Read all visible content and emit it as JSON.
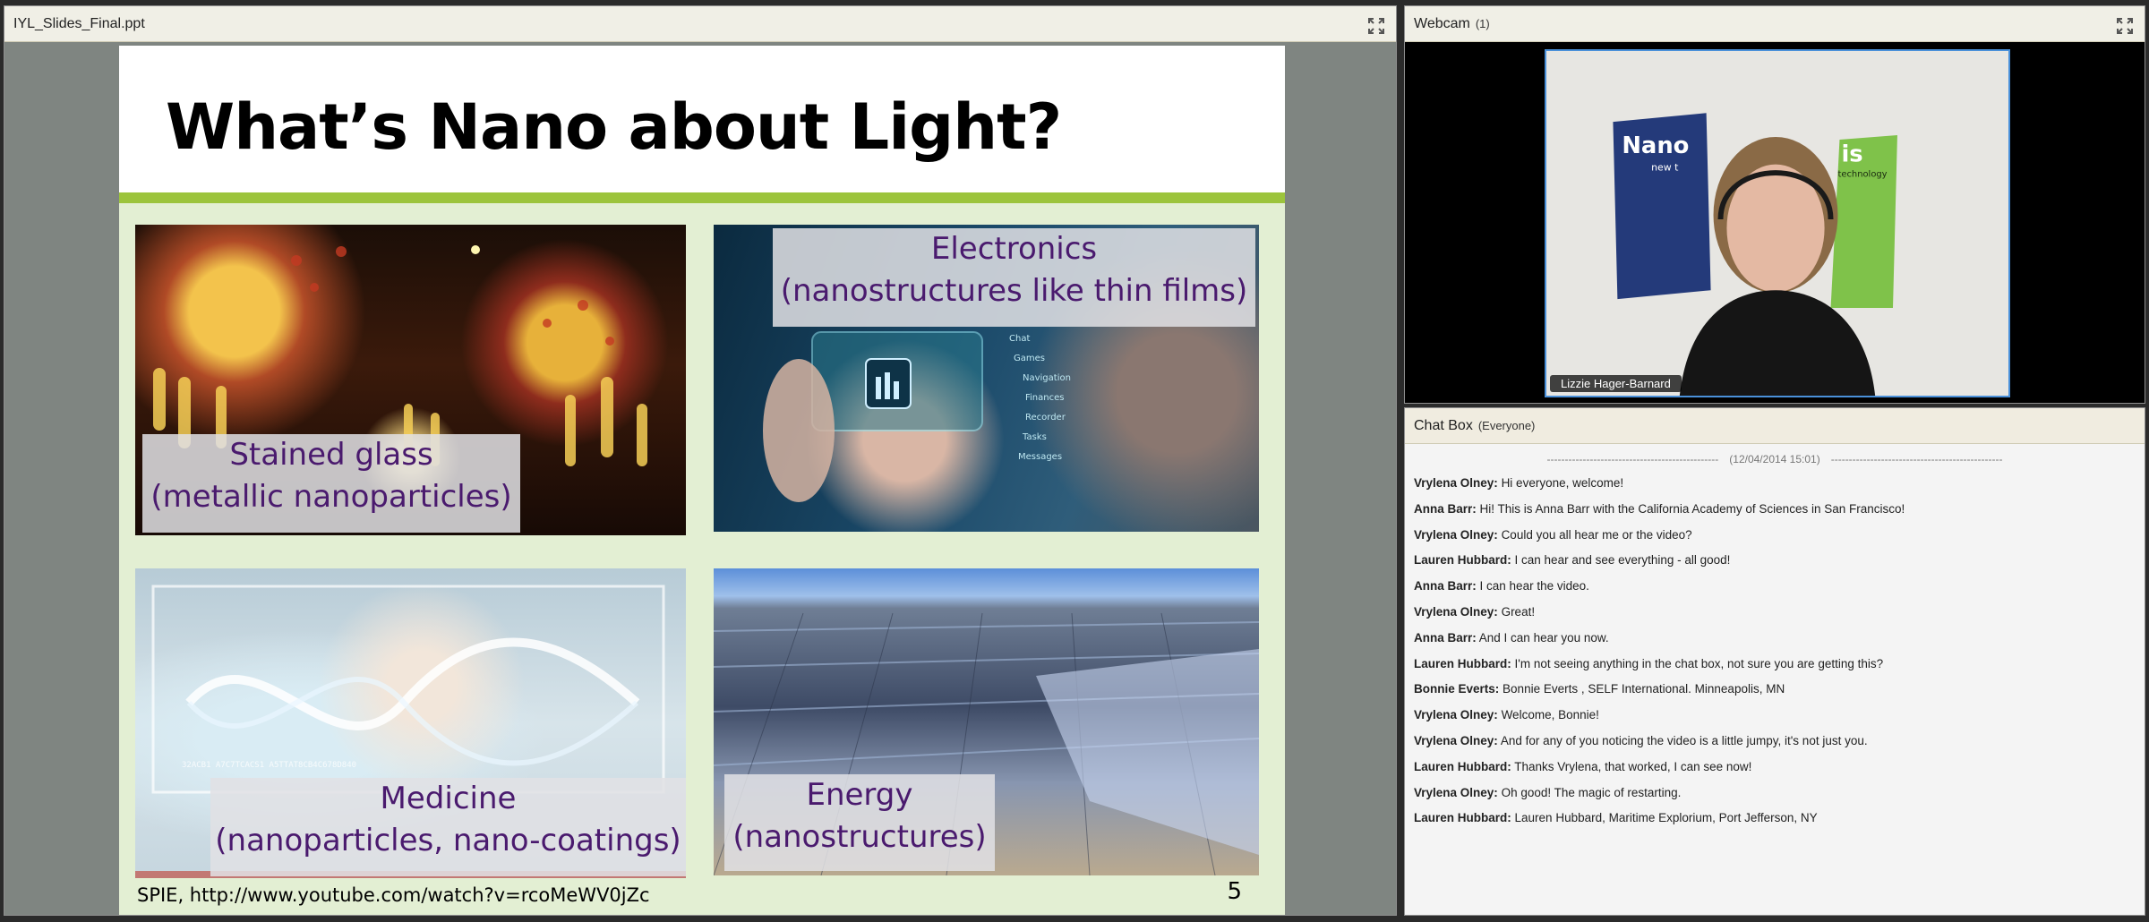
{
  "slides_pod": {
    "title": "IYL_Slides_Final.ppt",
    "expand_icon": "expand-arrows-icon",
    "slide": {
      "title": "What’s Nano about Light?",
      "captions": {
        "glass_line1": "Stained glass",
        "glass_line2": "(metallic nanoparticles)",
        "electronics_line1": "Electronics",
        "electronics_line2": "(nanostructures like thin films)",
        "medicine_line1": "Medicine",
        "medicine_line2": "(nanoparticles, nano-coatings)",
        "energy_line1": "Energy",
        "energy_line2": "(nanostructures)"
      },
      "ui_text": {
        "menu": [
          "Chat",
          "Games",
          "Navigation",
          "Finances",
          "Recorder",
          "Tasks",
          "Messages"
        ],
        "dna": "32ACB1 A7C7TCACS1 A5TTAT8CB4C678D840",
        "poster_left": "Nano",
        "poster_left_sub": "new t",
        "poster_right": "is",
        "poster_right_sub": "technology"
      },
      "footer": "SPIE, http://www.youtube.com/watch?v=rcoMeWV0jZc",
      "number": "5"
    },
    "colors": {
      "accent_green": "#9cc43c",
      "caption_purple": "#4a1a6e"
    }
  },
  "webcam_pod": {
    "title": "Webcam",
    "count": "(1)",
    "expand_icon": "expand-arrows-icon",
    "presenter_name": "Lizzie Hager-Barnard"
  },
  "chat_pod": {
    "title": "Chat Box",
    "scope": "(Everyone)",
    "separator_dashes": "------------------------------------------------",
    "timestamp": "(12/04/2014 15:01)",
    "messages": [
      {
        "sender": "Vrylena Olney:",
        "text": "Hi everyone, welcome!"
      },
      {
        "sender": "Anna Barr:",
        "text": "Hi! This is Anna Barr with the California Academy of Sciences in San Francisco!"
      },
      {
        "sender": "Vrylena Olney:",
        "text": "Could you all hear me or the video?"
      },
      {
        "sender": "Lauren Hubbard:",
        "text": "I can hear and see everything - all good!"
      },
      {
        "sender": "Anna Barr:",
        "text": "I can hear the video."
      },
      {
        "sender": "Vrylena Olney:",
        "text": "Great!"
      },
      {
        "sender": "Anna Barr:",
        "text": "And I can hear you now."
      },
      {
        "sender": "Lauren Hubbard:",
        "text": "I'm not seeing anything in the chat box, not sure you are getting this?"
      },
      {
        "sender": "Bonnie Everts:",
        "text": "Bonnie Everts , SELF International. Minneapolis, MN"
      },
      {
        "sender": "Vrylena Olney:",
        "text": "Welcome, Bonnie!"
      },
      {
        "sender": "Vrylena Olney:",
        "text": "And for any of you noticing the video is a little jumpy, it's not just you."
      },
      {
        "sender": "Lauren Hubbard:",
        "text": "Thanks Vrylena, that worked, I can see now!"
      },
      {
        "sender": "Vrylena Olney:",
        "text": "Oh good! The magic of restarting."
      },
      {
        "sender": "Lauren Hubbard:",
        "text": "Lauren Hubbard, Maritime Explorium, Port Jefferson, NY"
      }
    ]
  }
}
